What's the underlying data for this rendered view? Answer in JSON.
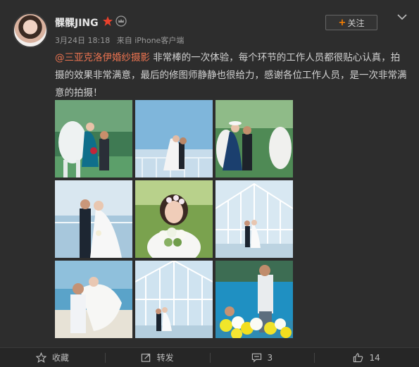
{
  "post": {
    "username": "髁髁JING",
    "date": "3月24日 18:18",
    "source": "来自 iPhone客户端",
    "follow_label": "关注",
    "follow_plus": "+",
    "mention": "@三亚克洛伊婚纱摄影",
    "text": " 非常棒的一次体验，每个环节的工作人员都很贴心认真，拍摄的效果非常满意，最后的修图师静静也很给力，感谢各位工作人员，是一次非常满意的拍摄！"
  },
  "photos": [
    {
      "name": "photo-1",
      "desc": "bride with white horse"
    },
    {
      "name": "photo-2",
      "desc": "couple on glass terrace"
    },
    {
      "name": "photo-3",
      "desc": "couple with two white horses"
    },
    {
      "name": "photo-4",
      "desc": "couple on terrace"
    },
    {
      "name": "photo-5",
      "desc": "bride with bouquet"
    },
    {
      "name": "photo-6",
      "desc": "couple in glass house"
    },
    {
      "name": "photo-7",
      "desc": "groom lifting bride by sea"
    },
    {
      "name": "photo-8",
      "desc": "couple in glass house"
    },
    {
      "name": "photo-9",
      "desc": "couple with balloons by pool"
    }
  ],
  "toolbar": {
    "favorite_label": "收藏",
    "repost_label": "转发",
    "comment_count": "3",
    "like_count": "14"
  },
  "colors": {
    "background": "#2d2d2d",
    "mention": "#eb7350",
    "accent": "#ff8200",
    "text": "#d2d2d2"
  }
}
